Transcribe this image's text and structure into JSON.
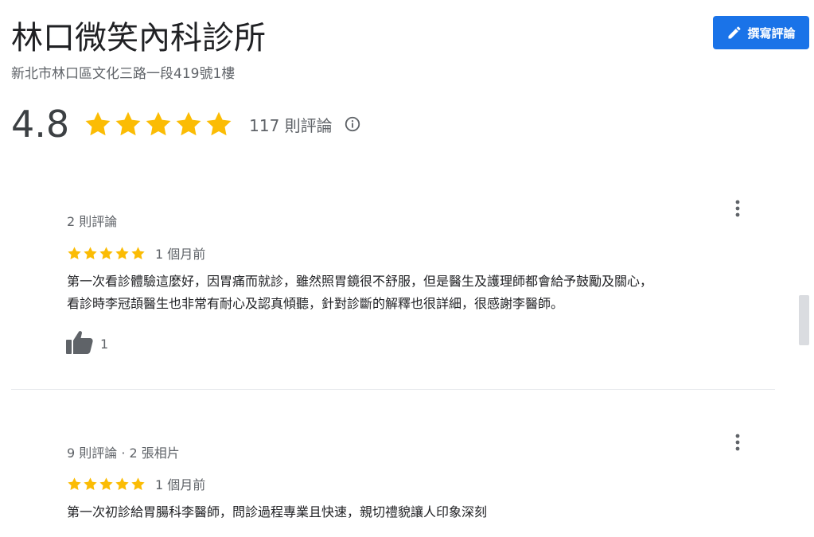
{
  "place": {
    "name": "林口微笑內科診所",
    "address": "新北市林口區文化三路一段419號1樓"
  },
  "header": {
    "write_review_label": "撰寫評論",
    "write_review_icon": "pencil-icon",
    "accent_color": "#1a73e8"
  },
  "summary": {
    "rating": "4.8",
    "stars": 5,
    "review_count_label": "117 則評論",
    "info_icon": "info-icon",
    "star_color": "#fbbc04"
  },
  "reviews": [
    {
      "meta": "2 則評論",
      "stars": 5,
      "time_ago": "1 個月前",
      "text_lines": [
        "第一次看診體驗這麼好，因胃痛而就診，雖然照胃鏡很不舒服，但是醫生及護理師都會給予鼓勵及關心，",
        "看診時李冠頡醫生也非常有耐心及認真傾聽，針對診斷的解釋也很詳細，很感謝李醫師。"
      ],
      "likes": "1",
      "more_icon": "more-vert-icon"
    },
    {
      "meta": "9 則評論 · 2 張相片",
      "stars": 5,
      "time_ago": "1 個月前",
      "text_lines": [
        "第一次初診給胃腸科李醫師，問診過程專業且快速，親切禮貌讓人印象深刻"
      ],
      "more_icon": "more-vert-icon"
    }
  ]
}
